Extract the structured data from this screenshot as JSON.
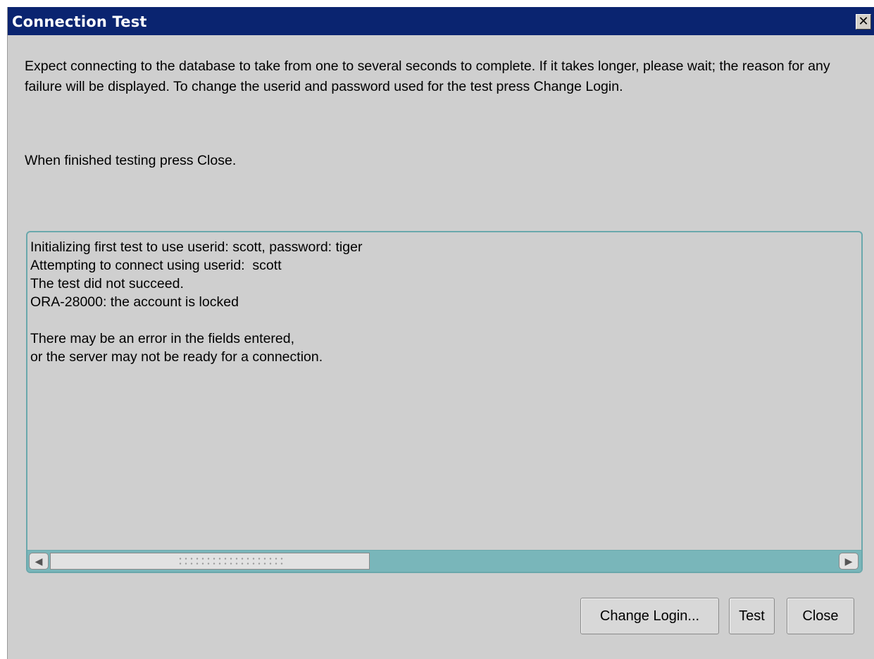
{
  "window": {
    "title": "Connection Test",
    "close_glyph": "✕"
  },
  "instructions": {
    "main": "Expect connecting to the database to take from one to several seconds to complete. If it takes longer, please wait; the reason for any failure will be displayed. To change the userid and password used for the test press Change Login.",
    "finish": "When finished testing press Close."
  },
  "log": {
    "lines": [
      "Initializing first test to use userid: scott, password: tiger",
      "Attempting to connect using userid:  scott",
      "The test did not succeed.",
      "ORA-28000: the account is locked",
      "",
      "There may be an error in the fields entered,",
      "or the server may not be ready for a connection."
    ]
  },
  "scrollbar": {
    "left_arrow": "◀",
    "right_arrow": "▶"
  },
  "buttons": {
    "change_login": "Change Login...",
    "test": "Test",
    "close": "Close"
  },
  "colors": {
    "titlebar": "#0a2470",
    "dialog_bg": "#cfcfcf",
    "scroll_track": "#79b6ba"
  },
  "icons": {
    "close": "close-icon",
    "scroll_left": "arrow-left-icon",
    "scroll_right": "arrow-right-icon"
  }
}
